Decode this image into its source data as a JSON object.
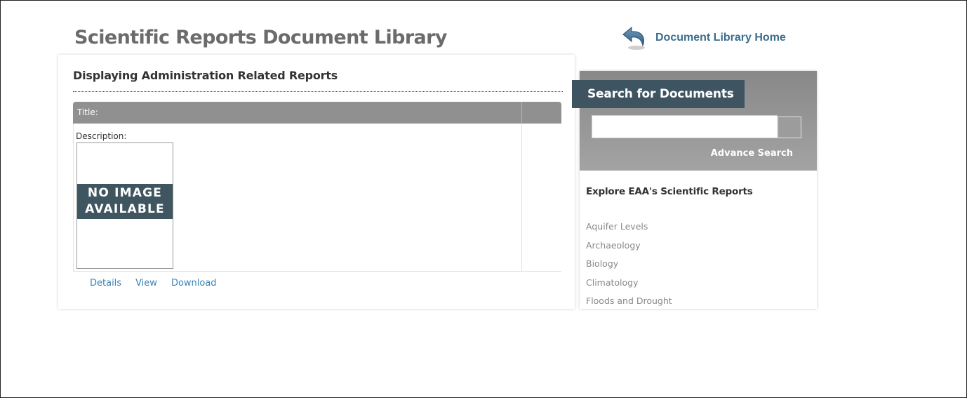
{
  "page": {
    "title": "Scientific Reports Document Library"
  },
  "home_link": {
    "label": "Document Library Home",
    "icon": "back-arrow-icon",
    "color": "#3d6d8c"
  },
  "main": {
    "section_title": "Displaying Administration Related Reports",
    "table": {
      "header_title": "Title:",
      "header_color": "#909090",
      "rows": [
        {
          "description_label": "Description:",
          "thumbnail": {
            "line1": "NO IMAGE",
            "line2": "AVAILABLE"
          },
          "actions": {
            "details": "Details",
            "view": "View",
            "download": "Download"
          }
        }
      ]
    }
  },
  "sidebar": {
    "search": {
      "title": "Search for Documents",
      "input_value": "",
      "input_placeholder": "",
      "advance_label": "Advance Search"
    },
    "explore_title": "Explore EAA's Scientific Reports",
    "topics": [
      "Aquifer Levels",
      "Archaeology",
      "Biology",
      "Climatology",
      "Floods and Drought"
    ]
  },
  "colors": {
    "title_gray": "#6b6b6b",
    "dark_slate": "#3e5461",
    "link_blue": "#3a82b8"
  }
}
